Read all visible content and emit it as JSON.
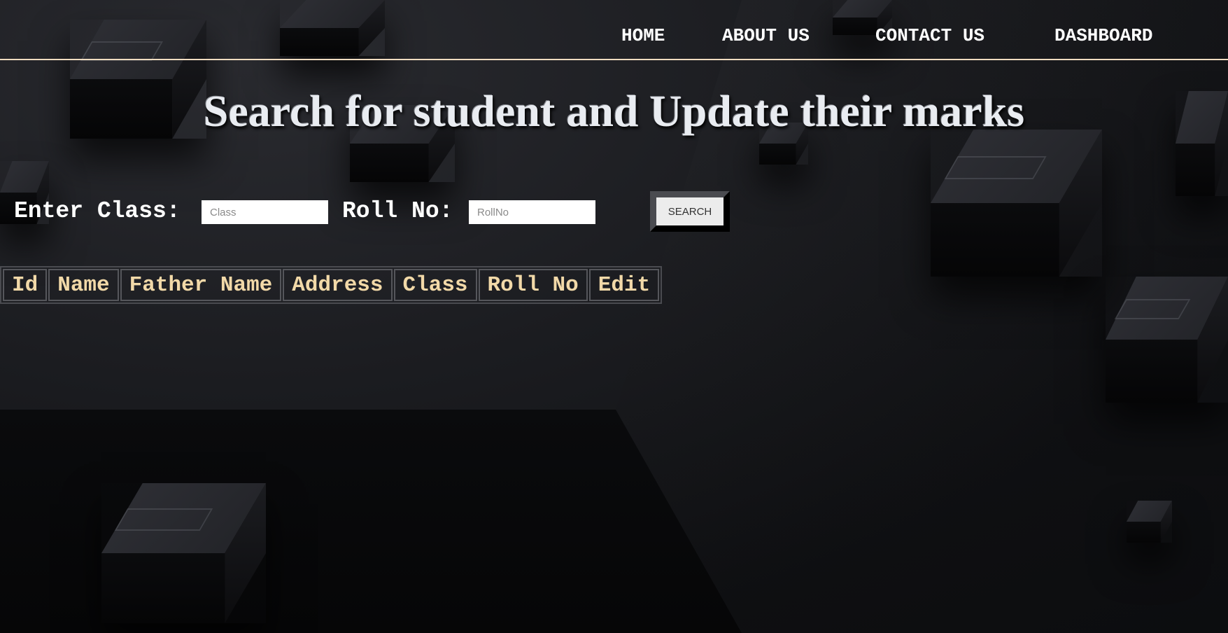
{
  "nav": {
    "items": [
      {
        "label": "HOME"
      },
      {
        "label": "ABOUT US"
      },
      {
        "label": "CONTACT US"
      },
      {
        "label": "DASHBOARD"
      }
    ]
  },
  "page": {
    "title": "Search for student and Update their marks"
  },
  "search": {
    "class_label": "Enter Class:",
    "class_placeholder": "Class",
    "class_value": "",
    "roll_label": "Roll No:",
    "roll_placeholder": "RollNo",
    "roll_value": "",
    "button_label": "SEARCH"
  },
  "table": {
    "columns": [
      "Id",
      "Name",
      "Father Name",
      "Address",
      "Class",
      "Roll No",
      "Edit"
    ],
    "rows": []
  },
  "colors": {
    "header_text": "#f2d9a8",
    "nav_underline": "#f0dcc0",
    "background": "#111215"
  }
}
